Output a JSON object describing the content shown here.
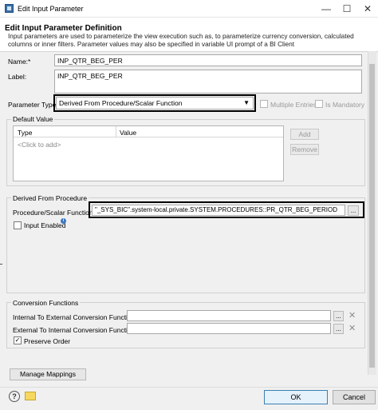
{
  "window": {
    "title": "Edit Input Parameter",
    "minimize": "—",
    "maximize": "☐",
    "close": "✕"
  },
  "header": {
    "title": "Edit Input Parameter Definition",
    "description": "Input parameters are used to parameterize the view execution such as, to parameterize currency conversion, calculated columns or inner filters. Parameter values may also be specified in variable UI prompt of a BI Client"
  },
  "form": {
    "name_label": "Name:*",
    "name_value": "INP_QTR_BEG_PER",
    "label_label": "Label:",
    "label_value": "INP_QTR_BEG_PER",
    "param_type_label": "Parameter Type:",
    "param_type_value": "Derived From Procedure/Scalar Function",
    "multiple_entries_label": "Multiple Entries",
    "is_mandatory_label": "Is Mandatory"
  },
  "default_value": {
    "group_title": "Default Value",
    "columns": [
      "Type",
      "Value"
    ],
    "placeholder_row": "<Click to add>",
    "add_button": "Add",
    "remove_button": "Remove"
  },
  "derived": {
    "group_title": "Derived From Procedure",
    "proc_label": "Procedure/Scalar Function:",
    "proc_value": "\"_SYS_BIC\".system-local.private.SYSTEM.PROCEDURES::PR_QTR_BEG_PERIOD",
    "browse_label": "...",
    "input_enabled_label": "Input Enabled",
    "info_icon": "i"
  },
  "conversion": {
    "group_title": "Conversion Functions",
    "internal_to_external_label": "Internal To External Conversion Function:",
    "external_to_internal_label": "External To Internal Conversion Function:",
    "browse_label": "...",
    "clear_icon": "✕",
    "preserve_order_label": "Preserve Order",
    "preserve_order_checked": "✓"
  },
  "footer": {
    "manage_mappings": "Manage Mappings",
    "help_icon": "?",
    "ok_button": "OK",
    "cancel_button": "Cancel"
  },
  "colors": {
    "highlight": "#000000",
    "ok_border": "#3c7fb1",
    "body_bg": "#f0f0f0"
  }
}
